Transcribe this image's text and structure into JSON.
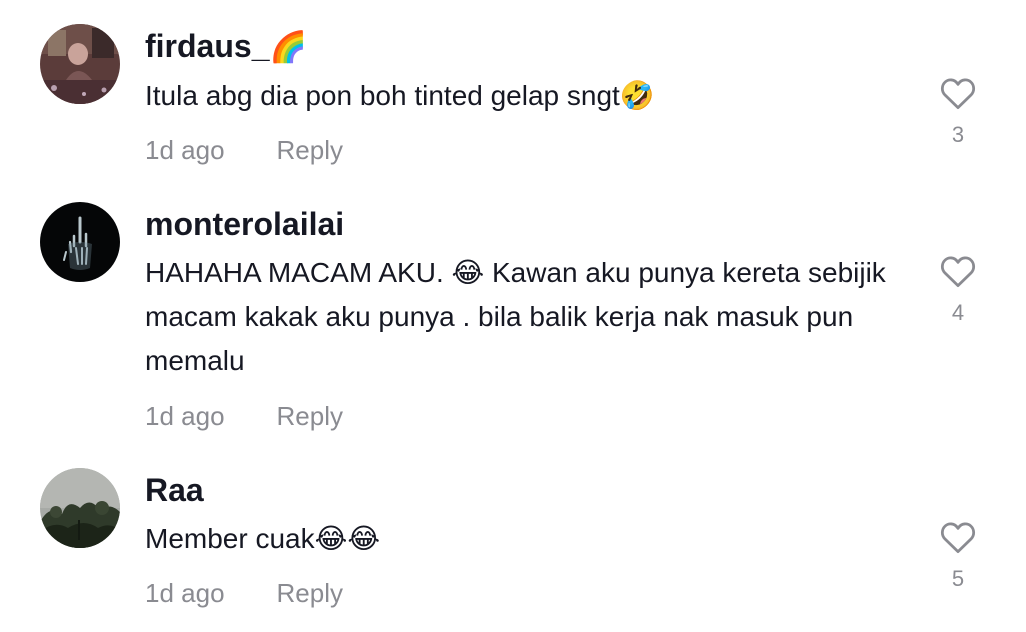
{
  "comments": [
    {
      "username": "firdaus_",
      "username_emoji": "🌈",
      "text": "Itula abg dia pon boh tinted gelap sngt🤣",
      "time": "1d ago",
      "reply_label": "Reply",
      "likes": "3",
      "avatar_icon": "user-photo-avatar"
    },
    {
      "username": "monterolailai",
      "text": "HAHAHA MACAM AKU. 😂 Kawan aku punya kereta sebijik macam kakak aku punya . bila balik kerja nak masuk pun memalu",
      "time": "1d ago",
      "reply_label": "Reply",
      "likes": "4",
      "avatar_icon": "xray-hand-avatar"
    },
    {
      "username": "Raa",
      "text": "Member cuak😂😂",
      "time": "1d ago",
      "reply_label": "Reply",
      "likes": "5",
      "avatar_icon": "tree-photo-avatar"
    }
  ],
  "colors": {
    "text_primary": "#161823",
    "text_secondary": "#8a8b91",
    "background": "#ffffff"
  }
}
